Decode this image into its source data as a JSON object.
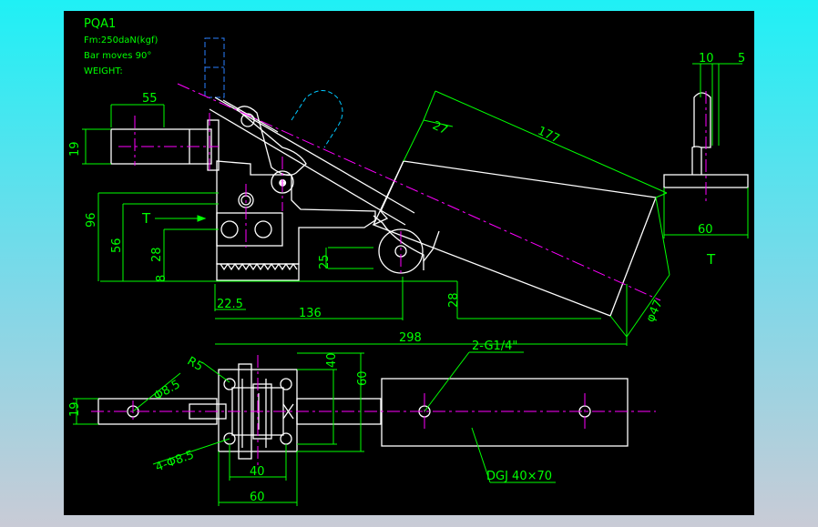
{
  "title": {
    "model": "PQA1",
    "force": "Fm:250daN(kgf)",
    "bar": "Bar moves 90°",
    "weight": "WEIGHT:"
  },
  "dimensions": {
    "d55": "55",
    "d19_top": "19",
    "d96": "96",
    "d56": "56",
    "d28_left": "28",
    "d8": "8",
    "d22_5": "22.5",
    "d136": "136",
    "d298": "298",
    "d25": "25",
    "d28_mid": "28",
    "d27": "27",
    "d177": "177",
    "d47": "φ47",
    "d10": "10",
    "d5": "5",
    "d60_side": "60",
    "t_side": "T",
    "t_main": "T",
    "d19_bottom": "19",
    "d8_5": "Φ8.5",
    "r5": "R5",
    "d40_v": "40",
    "d60_v": "60",
    "d4x8_5": "4-Φ8.5",
    "d40_h": "40",
    "d60_h": "60",
    "g1_4": "2-G1/4\"",
    "dgj": "DGJ 40×70"
  },
  "colors": {
    "outline": "#ffffff",
    "dimension": "#00ff00",
    "centerline": "#ff00ff",
    "hidden": "#2a7fff",
    "phantom": "#00c8ff"
  }
}
